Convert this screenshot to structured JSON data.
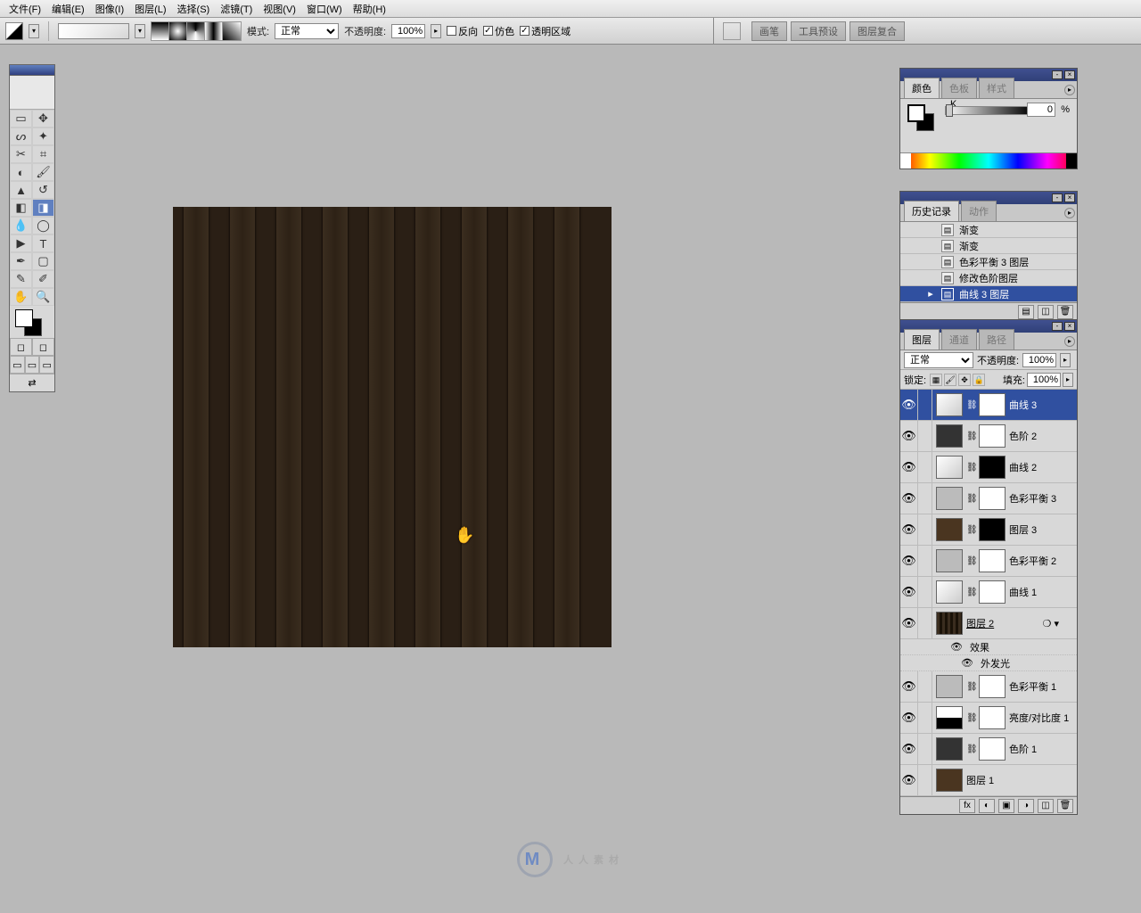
{
  "menu": [
    "文件(F)",
    "编辑(E)",
    "图像(I)",
    "图层(L)",
    "选择(S)",
    "滤镜(T)",
    "视图(V)",
    "窗口(W)",
    "帮助(H)"
  ],
  "options": {
    "mode_label": "模式:",
    "mode_value": "正常",
    "opacity_label": "不透明度:",
    "opacity_value": "100%",
    "reverse": "反向",
    "dither": "仿色",
    "transparent": "透明区域"
  },
  "dock": {
    "tabs": [
      "画笔",
      "工具预设",
      "图层复合"
    ]
  },
  "color_panel": {
    "tabs": [
      "颜色",
      "色板",
      "样式"
    ],
    "channel": "K",
    "value": "0",
    "pct": "%"
  },
  "history_panel": {
    "tabs": [
      "历史记录",
      "动作"
    ],
    "items": [
      {
        "label": "渐变",
        "active": false
      },
      {
        "label": "渐变",
        "active": false
      },
      {
        "label": "色彩平衡 3 图层",
        "active": false
      },
      {
        "label": "修改色阶图层",
        "active": false
      },
      {
        "label": "曲线 3 图层",
        "active": true
      }
    ]
  },
  "layers_panel": {
    "tabs": [
      "图层",
      "通道",
      "路径"
    ],
    "blend_mode": "正常",
    "opacity_label": "不透明度:",
    "opacity_value": "100%",
    "lock_label": "锁定:",
    "fill_label": "填充:",
    "fill_value": "100%",
    "effects_label": "效果",
    "outer_glow_label": "外发光",
    "layers": [
      {
        "name": "曲线 3",
        "thumb": "curves",
        "mask": "white",
        "active": true,
        "linked": true
      },
      {
        "name": "色阶 2",
        "thumb": "levels",
        "mask": "white",
        "linked": true
      },
      {
        "name": "曲线 2",
        "thumb": "curves",
        "mask": "black",
        "linked": true
      },
      {
        "name": "色彩平衡 3",
        "thumb": "balance",
        "mask": "white",
        "linked": true
      },
      {
        "name": "图层 3",
        "thumb": "wood2",
        "mask": "black",
        "linked": true
      },
      {
        "name": "色彩平衡 2",
        "thumb": "balance",
        "mask": "white",
        "linked": true
      },
      {
        "name": "曲线 1",
        "thumb": "curves",
        "mask": "white",
        "linked": true
      },
      {
        "name": "图层 2",
        "thumb": "wood",
        "fx": true,
        "underline": true
      },
      {
        "name": "色彩平衡 1",
        "thumb": "balance",
        "mask": "white",
        "linked": true
      },
      {
        "name": "亮度/对比度 1",
        "thumb": "bright",
        "mask": "white",
        "linked": true
      },
      {
        "name": "色阶 1",
        "thumb": "levels",
        "mask": "white",
        "linked": true
      },
      {
        "name": "图层 1",
        "thumb": "wood2"
      }
    ]
  },
  "watermark": "人人素材"
}
